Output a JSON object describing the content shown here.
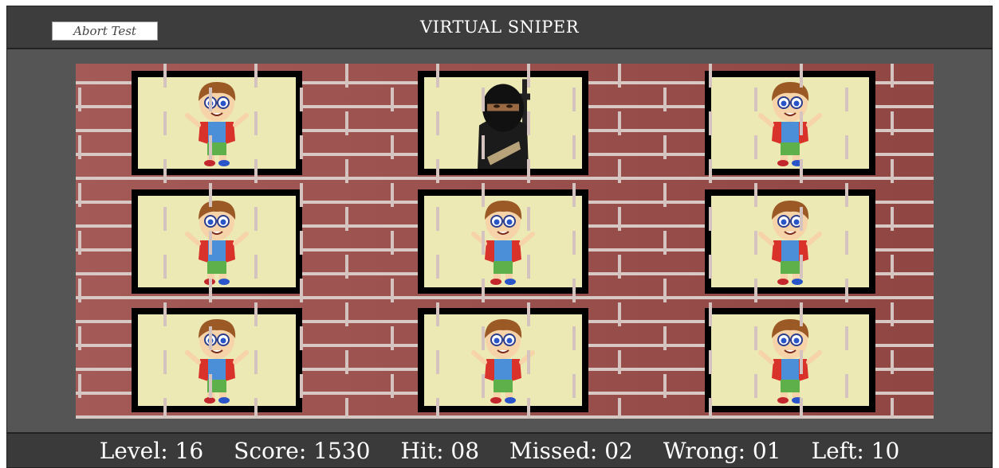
{
  "header": {
    "title": "VIRTUAL SNIPER",
    "abort_label": "Abort Test"
  },
  "grid": {
    "tiles": [
      {
        "character": "kid"
      },
      {
        "character": "gunman"
      },
      {
        "character": "kid"
      },
      {
        "character": "kid"
      },
      {
        "character": "kid"
      },
      {
        "character": "kid"
      },
      {
        "character": "kid"
      },
      {
        "character": "kid"
      },
      {
        "character": "kid"
      }
    ]
  },
  "status": {
    "level": "Level: 16",
    "score": "Score: 1530",
    "hit": "Hit: 08",
    "missed": "Missed: 02",
    "wrong": "Wrong: 01",
    "left": "Left: 10"
  },
  "colors": {
    "tile_background": "#ece9b4",
    "brick": "#9c4c48",
    "bar": "#3d3d3d"
  }
}
